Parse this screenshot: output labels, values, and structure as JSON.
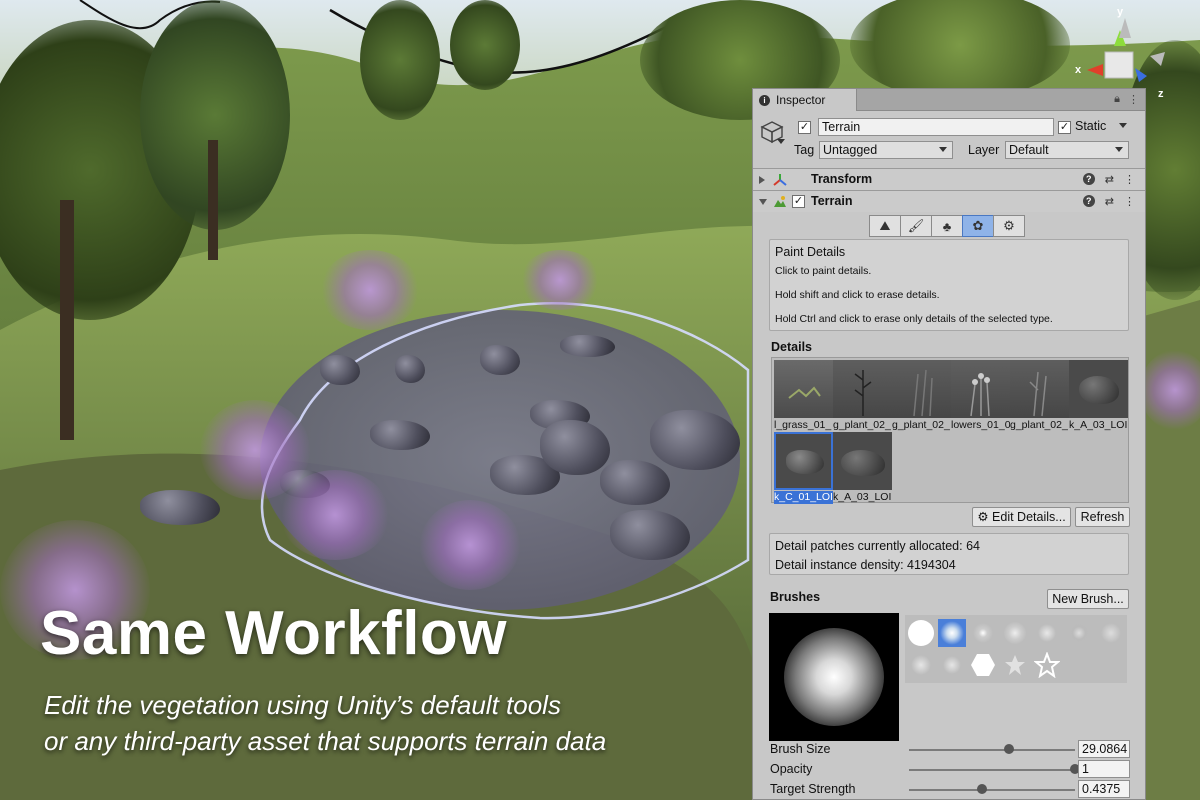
{
  "overlay": {
    "headline": "Same Workflow",
    "subtitle_line1": "Edit the vegetation using Unity’s default tools",
    "subtitle_line2": "or any third-party asset that supports terrain data"
  },
  "gizmo": {
    "y_label": "y",
    "x_label": "x",
    "z_label": "z"
  },
  "inspector": {
    "tab_title": "Inspector",
    "gameobject": {
      "name": "Terrain",
      "active_checked": true,
      "static_label": "Static",
      "static_checked": true,
      "tag_label": "Tag",
      "tag_value": "Untagged",
      "layer_label": "Layer",
      "layer_value": "Default"
    },
    "components": {
      "transform_title": "Transform",
      "terrain_title": "Terrain"
    },
    "tools": [
      "create-neighbor-terrains",
      "paint-terrain",
      "paint-trees",
      "paint-details",
      "terrain-settings"
    ],
    "paint_details": {
      "title": "Paint Details",
      "line1": "Click to paint details.",
      "line2": "Hold shift and click to erase details.",
      "line3": "Hold Ctrl and click to erase only details of the selected type."
    },
    "details": {
      "section_label": "Details",
      "items": [
        {
          "label": "l_grass_01_"
        },
        {
          "label": "g_plant_02_"
        },
        {
          "label": "g_plant_02_"
        },
        {
          "label": "lowers_01_0"
        },
        {
          "label": "g_plant_02_"
        },
        {
          "label": "k_A_03_LOI"
        },
        {
          "label": "k_C_01_LOI"
        },
        {
          "label": "k_A_03_LOI"
        }
      ],
      "selected_index": 6,
      "edit_button": "Edit Details...",
      "refresh_button": "Refresh",
      "patches_text": "Detail patches currently allocated: 64",
      "density_text": "Detail instance density: 4194304"
    },
    "brushes": {
      "section_label": "Brushes",
      "new_brush_button": "New Brush...",
      "size_label": "Brush Size",
      "size_value": "29.0864",
      "size_fraction": 0.6,
      "opacity_label": "Opacity",
      "opacity_value": "1",
      "opacity_fraction": 1.0,
      "strength_label": "Target Strength",
      "strength_value": "0.4375",
      "strength_fraction": 0.44
    }
  }
}
